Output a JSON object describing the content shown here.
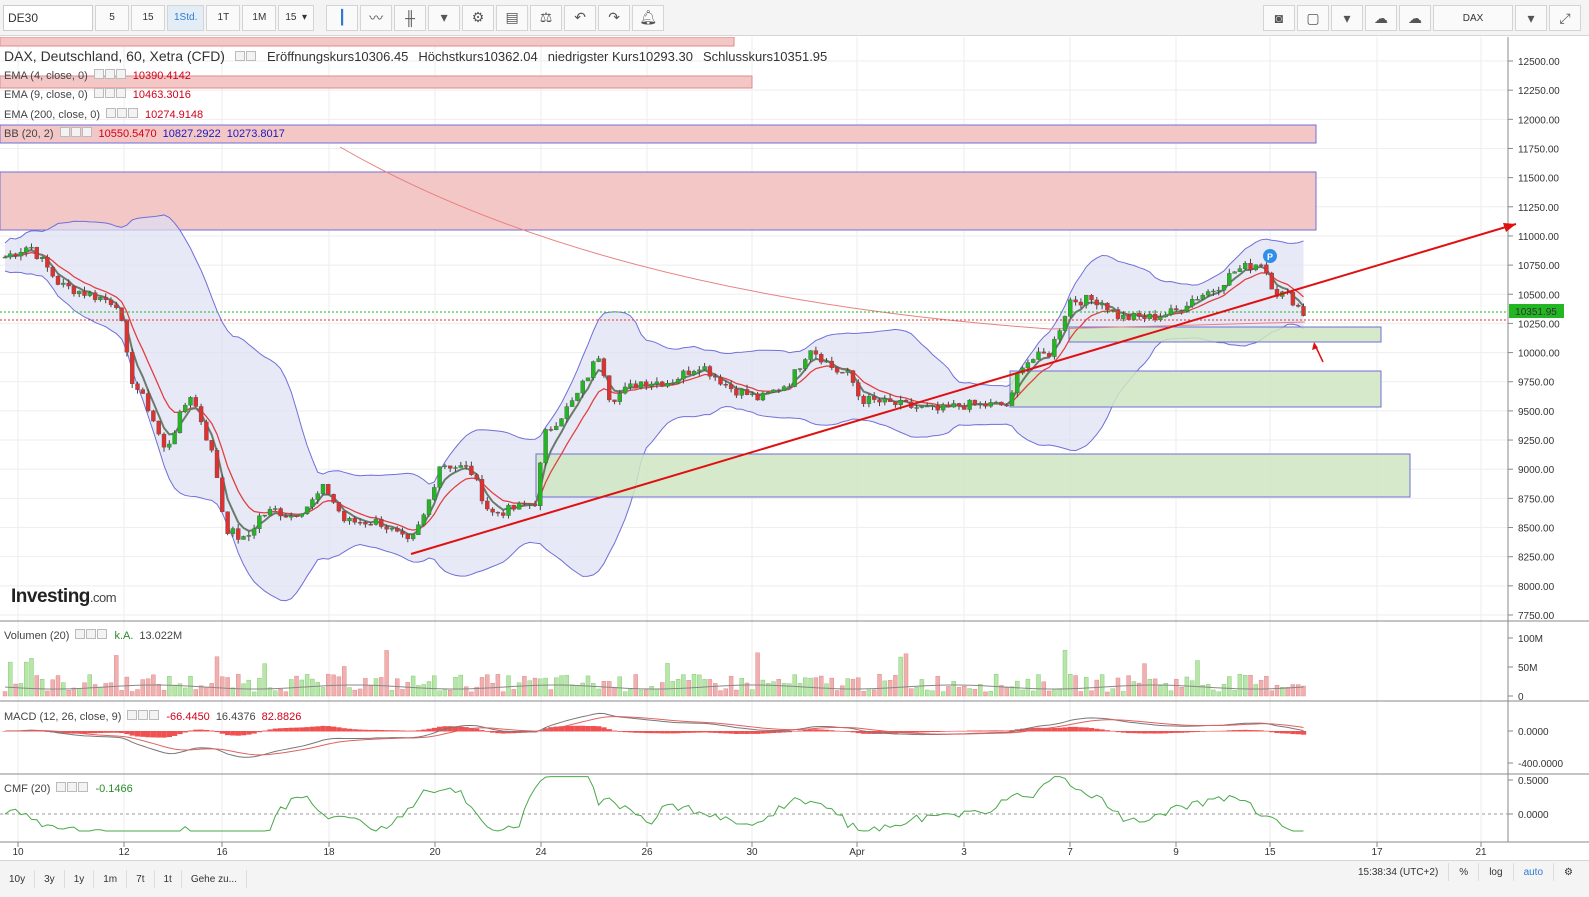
{
  "toolbar": {
    "symbol": "DE30",
    "intervals": [
      "5",
      "15",
      "1Std.",
      "1T",
      "1M",
      "15"
    ],
    "active_interval": "1Std.",
    "exchange_button": "DAX"
  },
  "main_legend": {
    "title": "DAX, Deutschland, 60, Xetra (CFD)",
    "open_label": "Eröffnungskurs",
    "open": "10306.45",
    "high_label": "Höchstkurs",
    "high": "10362.04",
    "low_label": "niedrigster Kurs",
    "low": "10293.30",
    "close_label": "Schlusskurs",
    "close": "10351.95"
  },
  "indicators": {
    "ema4": {
      "label": "EMA (4, close, 0)",
      "value": "10390.4142"
    },
    "ema9": {
      "label": "EMA (9, close, 0)",
      "value": "10463.3016"
    },
    "ema200": {
      "label": "EMA (200, close, 0)",
      "value": "10274.9148"
    },
    "bb": {
      "label": "BB (20, 2)",
      "v1": "10550.5470",
      "v2": "10827.2922",
      "v3": "10273.8017"
    },
    "volume": {
      "label": "Volumen (20)",
      "ka": "k.A.",
      "value": "13.022M"
    },
    "macd": {
      "label": "MACD (12, 26, close, 9)",
      "v1": "-66.4450",
      "v2": "16.4376",
      "v3": "82.8826"
    },
    "cmf": {
      "label": "CMF (20)",
      "value": "-0.1466"
    }
  },
  "price_axis": [
    "12500.00",
    "12250.00",
    "12000.00",
    "11750.00",
    "11500.00",
    "11250.00",
    "11000.00",
    "10750.00",
    "10500.00",
    "10250.00",
    "10000.00",
    "9750.00",
    "9500.00",
    "9250.00",
    "9000.00",
    "8750.00",
    "8500.00",
    "8250.00",
    "8000.00",
    "7750.00"
  ],
  "current_price_tag": "10351.95",
  "volume_axis": [
    "100M",
    "50M",
    "0"
  ],
  "macd_axis": [
    "0.0000",
    "-400.0000"
  ],
  "cmf_axis": [
    "0.5000",
    "0.0000"
  ],
  "date_axis": [
    "10",
    "12",
    "16",
    "18",
    "20",
    "24",
    "26",
    "30",
    "Apr",
    "3",
    "7",
    "9",
    "15",
    "17",
    "21"
  ],
  "bottom": {
    "ranges": [
      "10y",
      "3y",
      "1y",
      "1m",
      "7t",
      "1t"
    ],
    "goto": "Gehe zu...",
    "time": "15:38:34 (UTC+2)",
    "pct": "%",
    "log": "log",
    "auto": "auto"
  },
  "logo": {
    "main": "Investing",
    "suffix": ".com"
  },
  "colors": {
    "up": "#22b622",
    "down": "#e03030",
    "ema_red": "#e04040",
    "ema_gray": "#6b7b6b",
    "bb_fill": "#dde0f3",
    "bb_line": "#6f6fd8",
    "zone_red": "#f4c7c7",
    "zone_green": "#cfe6c2"
  }
}
